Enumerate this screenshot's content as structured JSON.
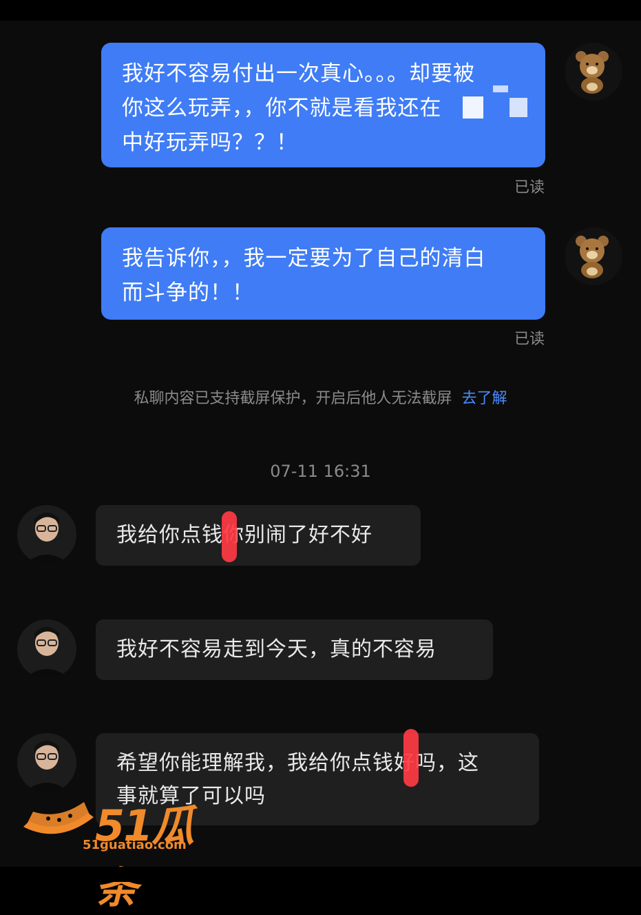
{
  "outgoing": [
    {
      "lines": [
        "我好不容易付出一次真心。。。却要被",
        "你这么玩弄，，你不就是看我还在",
        "中好玩弄吗？？！"
      ],
      "status": "已读"
    },
    {
      "lines": [
        "我告诉你，，我一定要为了自己的清白",
        "而斗争的！！"
      ],
      "status": "已读"
    }
  ],
  "notice": {
    "text": "私聊内容已支持截屏保护，开启后他人无法截屏",
    "link": "去了解"
  },
  "timestamp": "07-11 16:31",
  "incoming": [
    {
      "lines": [
        "我给你点钱你别闹了好不好"
      ]
    },
    {
      "lines": [
        "我好不容易走到今天，真的不容易"
      ]
    },
    {
      "lines": [
        "希望你能理解我，我给你点钱好吗，这",
        "事就算了可以吗"
      ]
    }
  ],
  "watermark": {
    "brand": "51瓜条",
    "url": "51guatiao.com"
  },
  "colors": {
    "outgoing_bubble": "#3f7cf5",
    "incoming_bubble": "#1f1f1f",
    "link": "#4a8cff",
    "redaction": "#ff3b45",
    "watermark": "#f08a2b"
  }
}
